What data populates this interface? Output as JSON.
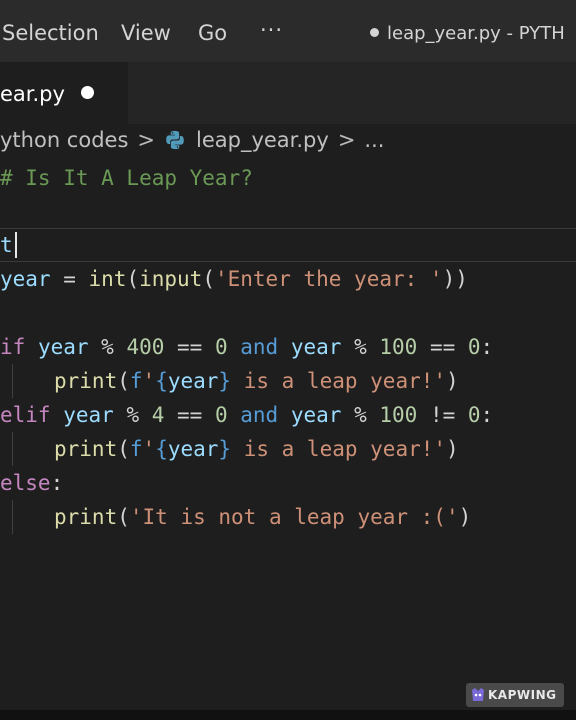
{
  "menubar": {
    "items": [
      "Selection",
      "View",
      "Go",
      "···"
    ],
    "window_title": "leap_year.py - PYTH"
  },
  "tab": {
    "label": "ear.py"
  },
  "breadcrumb": {
    "folder": "ython codes",
    "sep1": ">",
    "file": "leap_year.py",
    "sep2": ">",
    "more": "..."
  },
  "code": {
    "l1": "# Is It A Leap Year?",
    "l3": "t",
    "l4": {
      "var": "year",
      "eq": " = ",
      "fn1": "int",
      "p1": "(",
      "fn2": "input",
      "p2": "(",
      "str": "'Enter the year: '",
      "p3": "))"
    },
    "l6": {
      "kw": "if",
      "a": " year",
      "op1": " % ",
      "n1": "400",
      "op2": " == ",
      "n2": "0",
      "and": " and",
      "b": " year",
      "op3": " % ",
      "n3": "100",
      "op4": " == ",
      "n4": "0",
      "colon": ":"
    },
    "l7": {
      "fn": "print",
      "p1": "(",
      "f": "f",
      "q1": "'",
      "b1": "{",
      "var": "year",
      "b2": "}",
      "str": " is a leap year!'",
      "p2": ")"
    },
    "l8": {
      "kw": "elif",
      "a": " year",
      "op1": " % ",
      "n1": "4",
      "op2": " == ",
      "n2": "0",
      "and": " and",
      "b": " year",
      "op3": " % ",
      "n3": "100",
      "op4": " != ",
      "n4": "0",
      "colon": ":"
    },
    "l9": {
      "fn": "print",
      "p1": "(",
      "f": "f",
      "q1": "'",
      "b1": "{",
      "var": "year",
      "b2": "}",
      "str": " is a leap year!'",
      "p2": ")"
    },
    "l10": {
      "kw": "else",
      "colon": ":"
    },
    "l11": {
      "fn": "print",
      "p1": "(",
      "str": "'It is not a leap year :('",
      "p2": ")"
    }
  },
  "watermark": {
    "text": "KAPWING"
  }
}
